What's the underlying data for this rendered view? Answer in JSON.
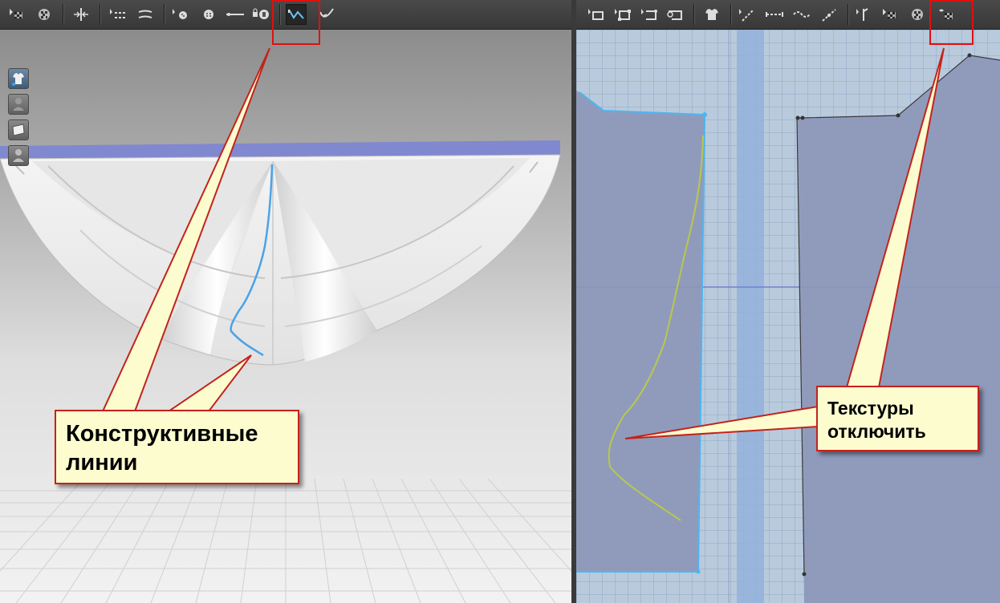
{
  "colors": {
    "callout_fill": "#fdfccf",
    "callout_border": "#c3231c",
    "highlight": "#e01010",
    "seam_line_3d": "#4aa3e8",
    "seam_line_2d": "#b9c84a",
    "pattern_fill": "#8c97b8",
    "table_top": "#8088cf",
    "toolbar": "#404040"
  },
  "viewport_3d": {
    "toolbar_icons": [
      "select-texture-icon",
      "texture-mesh-icon",
      "fold-arrange-icon",
      "sewing-line-icon",
      "sewing-segment-icon",
      "pin-icon",
      "button-icon",
      "topstitch-icon",
      "lock-button-icon",
      "show-internal-lines-icon",
      "bend-line-icon"
    ],
    "active_tool": "show-internal-lines-icon",
    "side_icons": [
      "avatar-garment-icon",
      "avatar-icon",
      "fabric-icon",
      "avatar-silhouette-icon"
    ]
  },
  "viewport_2d": {
    "toolbar_icons": [
      "edit-pattern-icon",
      "transform-pattern-icon",
      "edit-point-icon",
      "add-point-icon",
      "create-pattern-icon",
      "internal-line-icon",
      "segment-line-icon",
      "curve-line-icon",
      "seam-allowance-icon",
      "notch-icon",
      "select-texture-icon",
      "texture-mesh-icon",
      "hide-textures-icon"
    ],
    "highlighted_tool": "hide-textures-icon"
  },
  "callouts": {
    "constructive": {
      "line1": "Конструктивные",
      "line2": "линии"
    },
    "textures": {
      "line1": "Текстуры",
      "line2": "отключить"
    }
  }
}
